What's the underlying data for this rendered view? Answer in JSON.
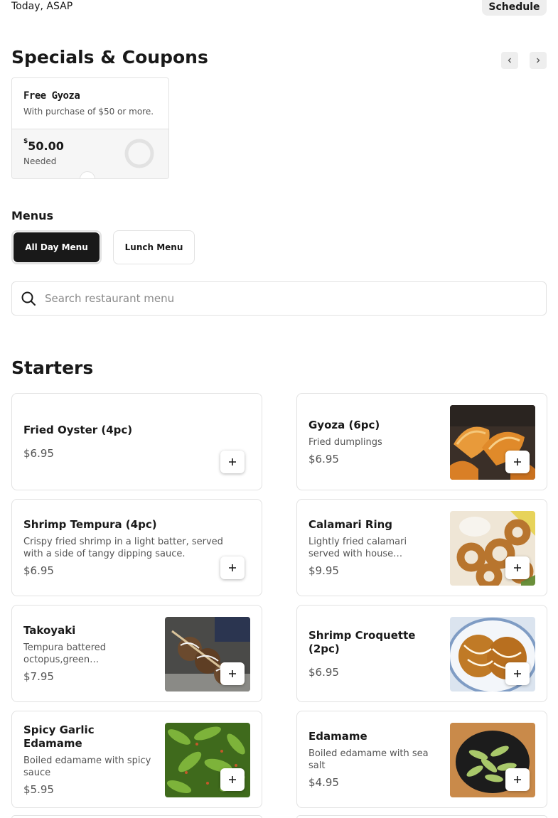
{
  "delivery": {
    "time_label": "Today, ASAP",
    "schedule_label": "Schedule"
  },
  "specials": {
    "title": "Specials & Coupons",
    "coupon": {
      "name": "Free Gyoza",
      "description": "With purchase of $50 or more.",
      "currency": "$",
      "amount": "50.00",
      "needed_label": "Needed",
      "progress": 0
    }
  },
  "menus": {
    "title": "Menus",
    "tabs": [
      {
        "label": "All Day Menu",
        "selected": true
      },
      {
        "label": "Lunch Menu",
        "selected": false
      }
    ]
  },
  "search": {
    "placeholder": "Search restaurant menu",
    "value": ""
  },
  "starters": {
    "title": "Starters",
    "items": [
      {
        "name": "Fried Oyster (4pc)",
        "description": "",
        "price": "$6.95",
        "image": ""
      },
      {
        "name": "Gyoza (6pc)",
        "description": "Fried dumplings",
        "price": "$6.95",
        "image": "gyoza-photo"
      },
      {
        "name": "Shrimp Tempura (4pc)",
        "description": "Crispy fried shrimp in a light batter, served with a side of tangy dipping sauce.",
        "price": "$6.95",
        "image": ""
      },
      {
        "name": "Calamari Ring",
        "description": "Lightly fried calamari served with house…",
        "price": "$9.95",
        "image": "calamari-photo"
      },
      {
        "name": "Takoyaki",
        "description": "Tempura battered octopus,green…",
        "price": "$7.95",
        "image": "takoyaki-photo"
      },
      {
        "name": "Shrimp Croquette (2pc)",
        "description": "",
        "price": "$6.95",
        "image": "croquette-photo"
      },
      {
        "name": "Spicy Garlic Edamame",
        "description": "Boiled edamame with spicy sauce",
        "price": "$5.95",
        "image": "spicy-edamame-photo"
      },
      {
        "name": "Edamame",
        "description": "Boiled edamame with sea salt",
        "price": "$4.95",
        "image": "edamame-photo"
      }
    ]
  },
  "colors": {
    "primary": "#191919",
    "secondary_text": "#545454",
    "border": "#e2e2e2",
    "chip_bg": "#eeeeee"
  }
}
